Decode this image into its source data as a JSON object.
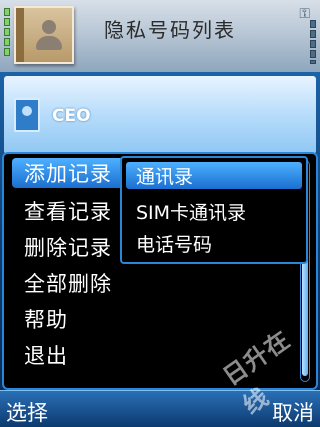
{
  "header": {
    "title": "隐私号码列表",
    "icons": [
      "signal-icon",
      "contacts-book-icon",
      "key-icon",
      "battery-icon"
    ]
  },
  "list": {
    "items": [
      {
        "label": "CEO",
        "icon": "contact-card-icon"
      }
    ]
  },
  "options_menu": {
    "items": [
      {
        "label": "添加记录"
      },
      {
        "label": "查看记录"
      },
      {
        "label": "删除记录"
      },
      {
        "label": "全部删除"
      },
      {
        "label": "帮助"
      },
      {
        "label": "退出"
      }
    ],
    "selected_index": 0
  },
  "submenu": {
    "items": [
      {
        "label": "通讯录"
      },
      {
        "label": "SIM卡通讯录"
      },
      {
        "label": "电话号码"
      }
    ],
    "selected_index": 0
  },
  "softkeys": {
    "left": "选择",
    "right": "取消"
  },
  "watermark": "日升在线",
  "colors": {
    "accent": "#2a86d9",
    "highlight": "#3a9cf0",
    "menu_bg": "#000000"
  }
}
